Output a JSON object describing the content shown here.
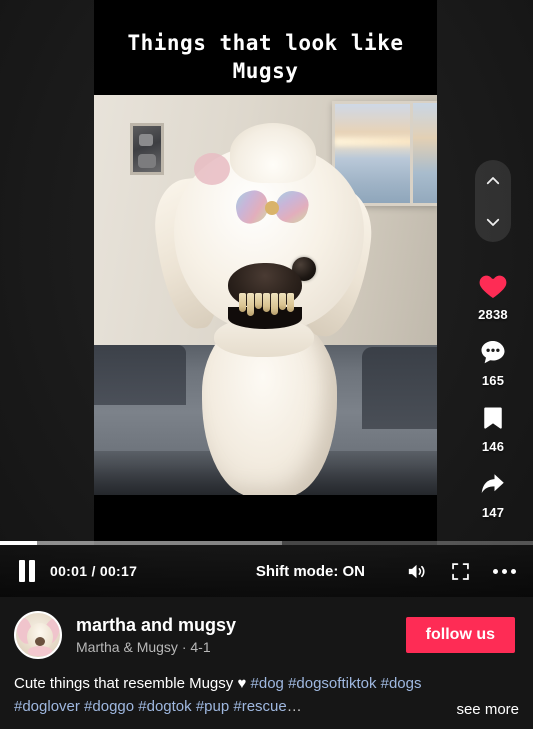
{
  "video": {
    "overlay_title": "Things that look like Mugsy"
  },
  "rail": {
    "nav_up_icon": "chevron-up-icon",
    "nav_down_icon": "chevron-down-icon",
    "actions": [
      {
        "icon": "heart-icon",
        "count": "2838",
        "color": "#fe2c55"
      },
      {
        "icon": "comment-icon",
        "count": "165",
        "color": "#ffffff"
      },
      {
        "icon": "bookmark-icon",
        "count": "146",
        "color": "#ffffff"
      },
      {
        "icon": "share-icon",
        "count": "147",
        "color": "#ffffff"
      }
    ]
  },
  "controls": {
    "play_state_icon": "pause-icon",
    "current_time": "00:01",
    "total_time": "00:17",
    "time_display": "00:01 / 00:17",
    "shift_mode_label": "Shift mode: ON",
    "volume_icon": "volume-on-icon",
    "fullscreen_icon": "fullscreen-icon",
    "more_icon": "more-ellipsis-icon",
    "progress_percent": 7,
    "buffered_percent": 53
  },
  "author": {
    "avatar_icon": "dog-avatar",
    "username": "martha and mugsy",
    "subtitle": "Martha & Mugsy · 4-1",
    "follow_label": "follow us",
    "follow_color": "#fe2c55"
  },
  "caption": {
    "text": "Cute things that resemble Mugsy ",
    "heart_glyph": "♥",
    "hashtags_line1": "#dog #dogsoftiktok #dogs",
    "hashtags_line2": "#doglover #doggo #dogtok #pup #rescue",
    "ellipsis": "…",
    "see_more_label": "see more",
    "hashtag_color": "#9fb8e0"
  }
}
